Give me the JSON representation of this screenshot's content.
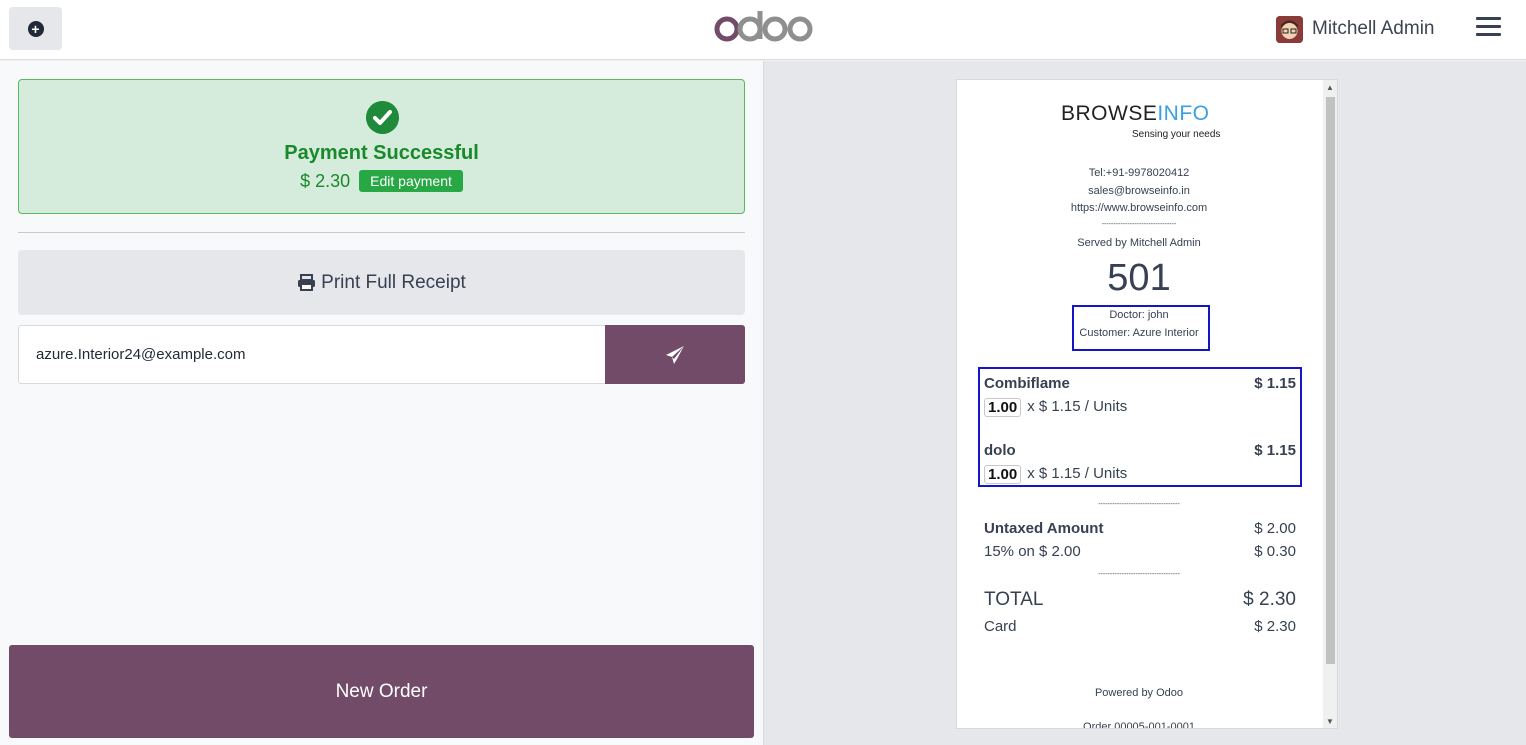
{
  "topbar": {
    "user_name": "Mitchell Admin"
  },
  "payment": {
    "title": "Payment Successful",
    "amount": "$ 2.30",
    "edit_label": "Edit payment"
  },
  "actions": {
    "print_label": "Print Full Receipt",
    "email_value": "azure.Interior24@example.com",
    "new_order_label": "New Order"
  },
  "receipt": {
    "brand_main": "BROWSE",
    "brand_accent": "INFO",
    "tagline": "Sensing your needs",
    "phone": "Tel:+91-9978020412",
    "email": "sales@browseinfo.in",
    "website": "https://www.browseinfo.com",
    "separator_short": "--------------------------------",
    "served_by": "Served by Mitchell Admin",
    "order_number": "501",
    "doctor": "Doctor: john",
    "customer": "Customer: Azure Interior",
    "lines": [
      {
        "name": "Combiflame",
        "total": "$ 1.15",
        "qty": "1.00",
        "unit_price": "x $ 1.15 / Units"
      },
      {
        "name": "dolo",
        "total": "$ 1.15",
        "qty": "1.00",
        "unit_price": "x $ 1.15 / Units"
      }
    ],
    "separator_long": "-----------------------------------",
    "untaxed_label": "Untaxed Amount",
    "untaxed_value": "$ 2.00",
    "tax_label": "15% on $ 2.00",
    "tax_value": "$ 0.30",
    "total_label": "TOTAL",
    "total_value": "$ 2.30",
    "payment_method": "Card",
    "payment_value": "$ 2.30",
    "powered_by": "Powered by Odoo",
    "order_ref": "Order 00005-001-0001"
  }
}
